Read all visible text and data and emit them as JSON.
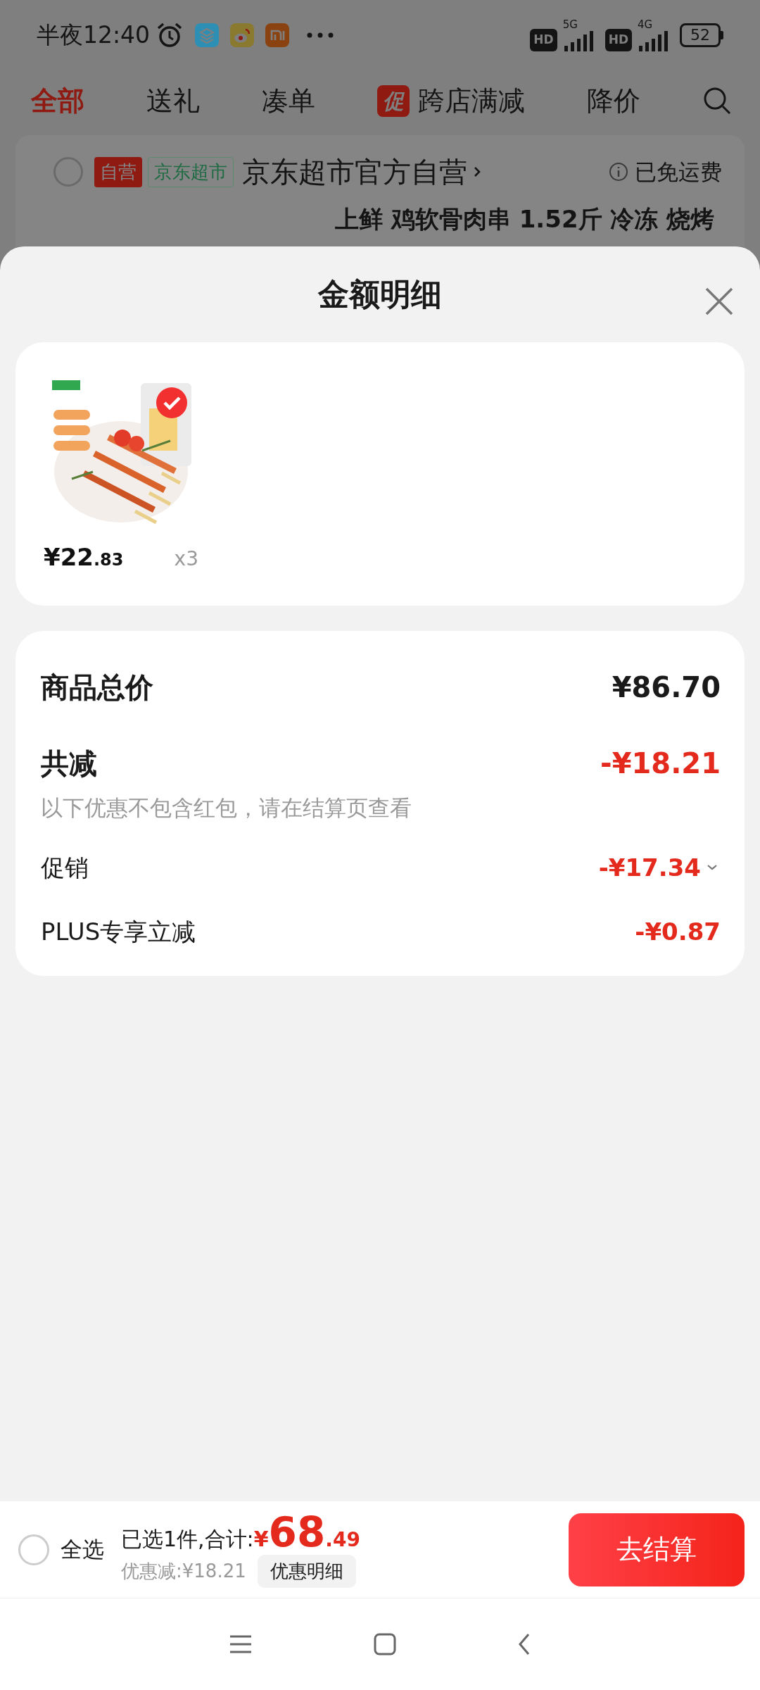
{
  "status_bar": {
    "time": "半夜12:40",
    "hd_1": "HD",
    "network_1": "5G",
    "hd_2": "HD",
    "network_2": "4G",
    "battery": "52"
  },
  "tabs": [
    {
      "label": "全部",
      "selected": true
    },
    {
      "label": "送礼",
      "selected": false
    },
    {
      "label": "凑单",
      "selected": false
    },
    {
      "label": "跨店满减",
      "selected": false,
      "badge": "促"
    },
    {
      "label": "降价",
      "selected": false
    }
  ],
  "store": {
    "checked": false,
    "tags": [
      {
        "label": "自营",
        "kind": "solid"
      },
      {
        "label": "京东超市",
        "kind": "outline"
      }
    ],
    "name": "京东超市官方自营",
    "shipping": "已免运费"
  },
  "background_product": {
    "title": "上鲜 鸡软骨肉串 1.52斤 冷冻 烧烤"
  },
  "sheet": {
    "title": "金额明细",
    "items": [
      {
        "kind": "picture",
        "checked": true,
        "price_main": "¥22",
        "price_decimal": ".83",
        "quantity": "x3"
      }
    ],
    "total": {
      "label": "商品总价",
      "value": "¥86.70"
    },
    "reduction": {
      "label": "共减",
      "value": "-¥18.21",
      "note": "以下优惠不包含红包，请在结算页查看"
    },
    "details": [
      {
        "label": "促销",
        "value": "-¥17.34",
        "expandable": true
      },
      {
        "label": "PLUS专享立减",
        "value": "-¥0.87",
        "expandable": false
      }
    ]
  },
  "footer": {
    "select_all": {
      "label": "全选",
      "checked": false
    },
    "summary": "已选1件,合计:",
    "currency": "¥",
    "amount_int": "68",
    "amount_dec": ".49",
    "discount": "优惠减:¥18.21",
    "details_button": "优惠明细",
    "checkout": "去结算"
  }
}
